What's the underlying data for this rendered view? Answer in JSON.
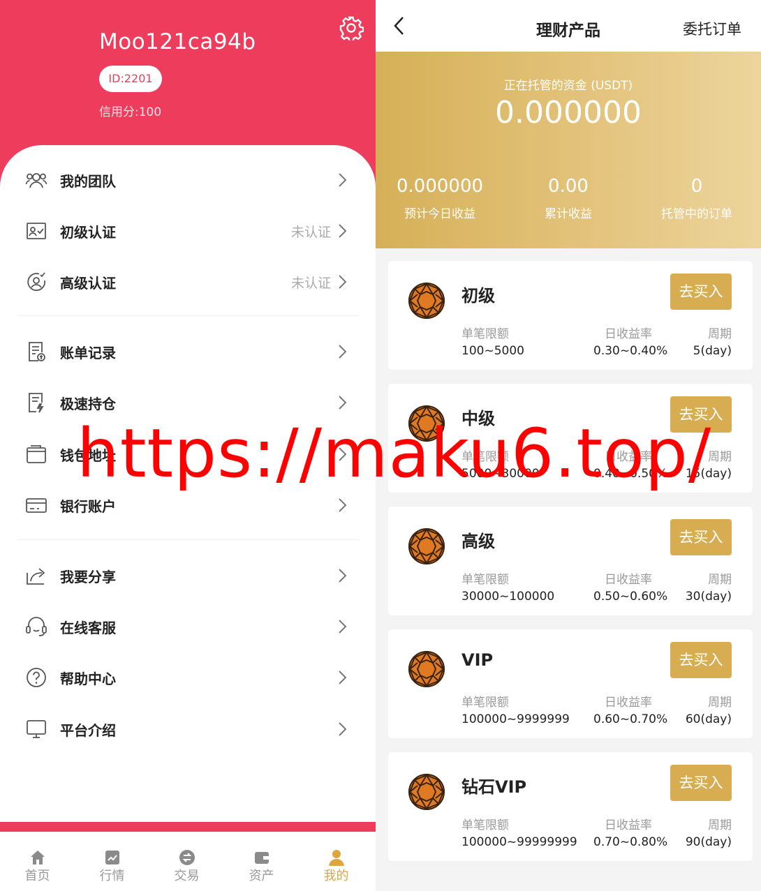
{
  "profile": {
    "username": "Moo121ca94b",
    "id_label": "ID:2201",
    "credit_label": "信用分:100"
  },
  "menu": {
    "items": [
      {
        "label": "我的团队",
        "status": "",
        "icon": "team-icon"
      },
      {
        "label": "初级认证",
        "status": "未认证",
        "icon": "id-card-icon"
      },
      {
        "label": "高级认证",
        "status": "未认证",
        "icon": "verified-user-icon"
      },
      {
        "label": "账单记录",
        "status": "",
        "icon": "bill-icon"
      },
      {
        "label": "极速持仓",
        "status": "",
        "icon": "flash-document-icon"
      },
      {
        "label": "钱包地址",
        "status": "",
        "icon": "wallet-icon"
      },
      {
        "label": "银行账户",
        "status": "",
        "icon": "bank-card-icon"
      },
      {
        "label": "我要分享",
        "status": "",
        "icon": "share-icon"
      },
      {
        "label": "在线客服",
        "status": "",
        "icon": "headset-icon"
      },
      {
        "label": "帮助中心",
        "status": "",
        "icon": "help-icon"
      },
      {
        "label": "平台介绍",
        "status": "",
        "icon": "monitor-icon"
      }
    ]
  },
  "tabbar": {
    "tabs": [
      {
        "label": "首页",
        "icon": "home-icon"
      },
      {
        "label": "行情",
        "icon": "chart-icon"
      },
      {
        "label": "交易",
        "icon": "exchange-icon"
      },
      {
        "label": "资产",
        "icon": "wallet-icon"
      },
      {
        "label": "我的",
        "icon": "user-icon",
        "active": true
      }
    ]
  },
  "finance": {
    "nav": {
      "title": "理财产品",
      "right_link": "委托订单"
    },
    "banner": {
      "label": "正在托管的资金 (USDT)",
      "value": "0.000000",
      "stats": [
        {
          "value": "0.000000",
          "label": "预计今日收益"
        },
        {
          "value": "0.00",
          "label": "累计收益"
        },
        {
          "value": "0",
          "label": "托管中的订单"
        }
      ]
    },
    "columns": {
      "limit": "单笔限额",
      "rate": "日收益率",
      "period": "周期"
    },
    "buy_label": "去买入",
    "products": [
      {
        "name": "初级",
        "limit": "100~5000",
        "rate": "0.30~0.40%",
        "period": "5(day)"
      },
      {
        "name": "中级",
        "limit": "5000~30000",
        "rate": "0.40~0.50%",
        "period": "15(day)"
      },
      {
        "name": "高级",
        "limit": "30000~100000",
        "rate": "0.50~0.60%",
        "period": "30(day)"
      },
      {
        "name": "VIP",
        "limit": "100000~9999999",
        "rate": "0.60~0.70%",
        "period": "60(day)"
      },
      {
        "name": "钻石VIP",
        "limit": "100000~99999999",
        "rate": "0.70~0.80%",
        "period": "90(day)"
      }
    ]
  },
  "watermark": "https://maku6.top/",
  "colors": {
    "primary_red": "#ee3d5c",
    "gold": "#d8ad52"
  }
}
